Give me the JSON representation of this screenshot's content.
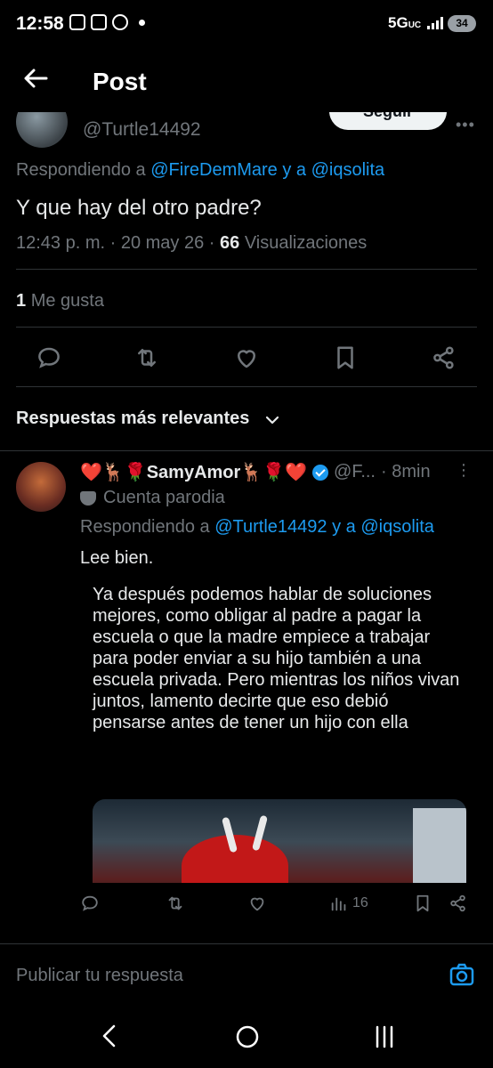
{
  "status_bar": {
    "time": "12:58",
    "network": "5G",
    "network_sub": "UC",
    "battery": "34"
  },
  "header": {
    "title": "Post"
  },
  "post": {
    "handle": "@Turtle14492",
    "follow_label": "Seguir",
    "replying_prefix": "Respondiendo a",
    "replying_users": "@FireDemMare y a @iqsolita",
    "text": "Y que hay del otro padre?",
    "time": "12:43 p. m. · 20 may 26 ·",
    "views_count": "66",
    "views_label": "Visualizaciones",
    "likes_count": "1",
    "likes_label": "Me gusta"
  },
  "sort": {
    "label": "Respuestas más relevantes"
  },
  "reply": {
    "name": "❤️🦌🌹SamyAmor🦌🌹❤️",
    "handle": "@F...",
    "time": "· 8min",
    "parody_label": "Cuenta parodia",
    "replying_prefix": "Respondiendo a",
    "replying_users": "@Turtle14492 y a @iqsolita",
    "text": "Lee bien.",
    "quote_text": "Ya después podemos hablar de soluciones mejores, como obligar al padre a pagar la escuela o que la madre empiece a trabajar para poder enviar a su hijo también a una escuela privada. Pero mientras los niños vivan juntos, lamento decirte que eso debió pensarse antes de tener un hijo con ella",
    "views": "16"
  },
  "compose": {
    "placeholder": "Publicar tu respuesta"
  },
  "colors": {
    "accent": "#1d9bf0",
    "muted": "#71767b",
    "text": "#e7e9ea",
    "divider": "#2f3336"
  },
  "icons": [
    "back-arrow-icon",
    "reply-icon",
    "retweet-icon",
    "like-icon",
    "bookmark-icon",
    "share-icon",
    "chevron-down-icon",
    "verified-icon",
    "parody-mask-icon",
    "views-icon",
    "camera-icon",
    "nav-back-icon",
    "nav-home-icon",
    "nav-recents-icon"
  ]
}
